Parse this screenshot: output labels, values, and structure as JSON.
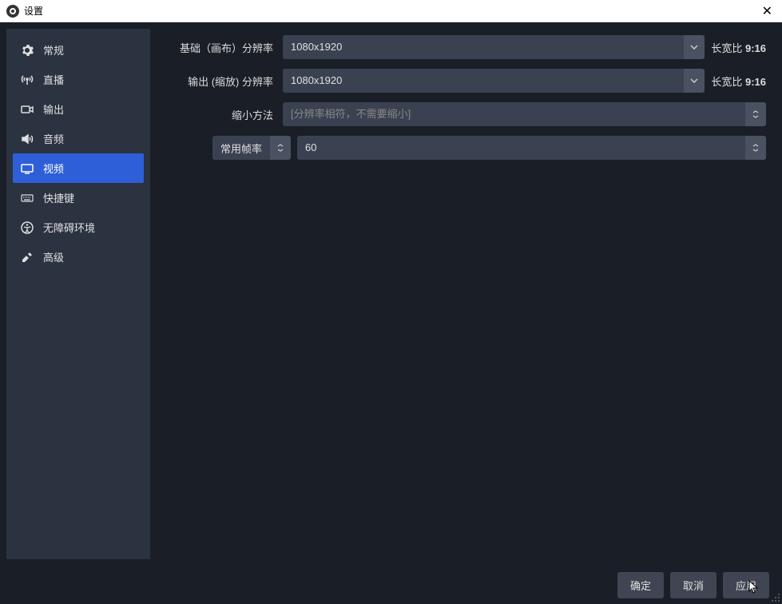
{
  "window": {
    "title": "设置"
  },
  "sidebar": {
    "items": [
      {
        "label": "常规"
      },
      {
        "label": "直播"
      },
      {
        "label": "输出"
      },
      {
        "label": "音频"
      },
      {
        "label": "视频"
      },
      {
        "label": "快捷键"
      },
      {
        "label": "无障碍环境"
      },
      {
        "label": "高级"
      }
    ],
    "active_index": 4
  },
  "video": {
    "base_res_label": "基础（画布）分辨率",
    "base_res_value": "1080x1920",
    "base_aspect_prefix": "长宽比 ",
    "base_aspect_value": "9:16",
    "output_res_label": "输出 (缩放) 分辨率",
    "output_res_value": "1080x1920",
    "output_aspect_prefix": "长宽比 ",
    "output_aspect_value": "9:16",
    "downscale_label": "缩小方法",
    "downscale_placeholder": "[分辨率相符，不需要缩小]",
    "fps_type_label": "常用帧率",
    "fps_value": "60"
  },
  "footer": {
    "ok": "确定",
    "cancel": "取消",
    "apply": "应用"
  }
}
